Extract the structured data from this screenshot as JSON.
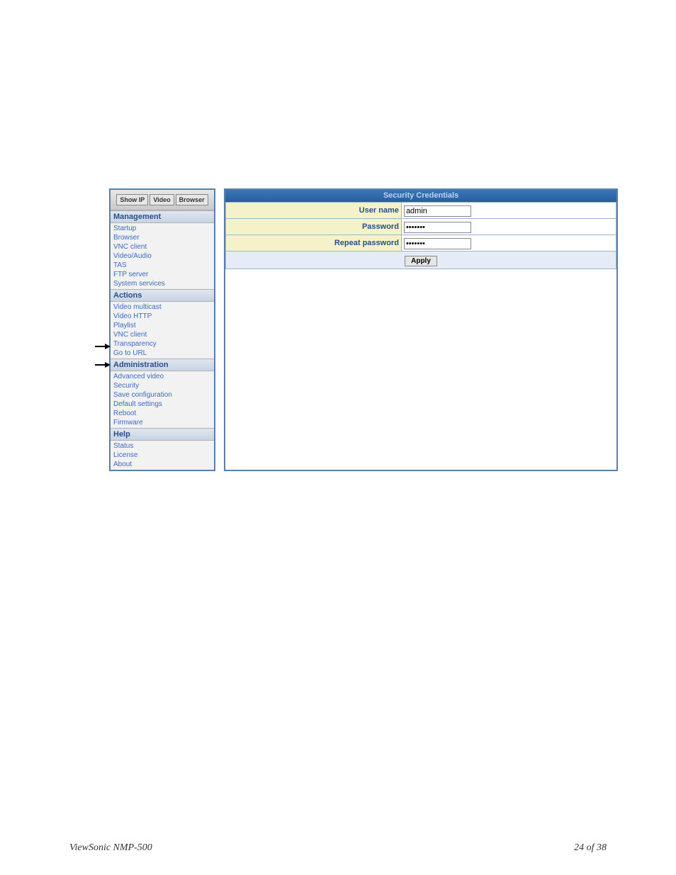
{
  "sidebar": {
    "buttons": {
      "show_ip": "Show IP",
      "video": "Video",
      "browser": "Browser"
    },
    "sections": [
      {
        "title": "Management",
        "items": [
          "Startup",
          "Browser",
          "VNC client",
          "Video/Audio",
          "TAS",
          "FTP server",
          "System services"
        ]
      },
      {
        "title": "Actions",
        "items": [
          "Video multicast",
          "Video HTTP",
          "Playlist",
          "VNC client",
          "Transparency",
          "Go to URL"
        ]
      },
      {
        "title": "Administration",
        "items": [
          "Advanced video",
          "Security",
          "Save configuration",
          "Default settings",
          "Reboot",
          "Firmware"
        ]
      },
      {
        "title": "Help",
        "items": [
          "Status",
          "License",
          "About"
        ]
      }
    ]
  },
  "main": {
    "header": "Security Credentials",
    "rows": {
      "user_name_label": "User name",
      "user_name_value": "admin",
      "password_label": "Password",
      "password_value": "*******",
      "repeat_password_label": "Repeat password",
      "repeat_password_value": "*******",
      "apply_label": "Apply"
    }
  },
  "footer": {
    "left": "ViewSonic NMP-500",
    "right": "24 of  38"
  }
}
